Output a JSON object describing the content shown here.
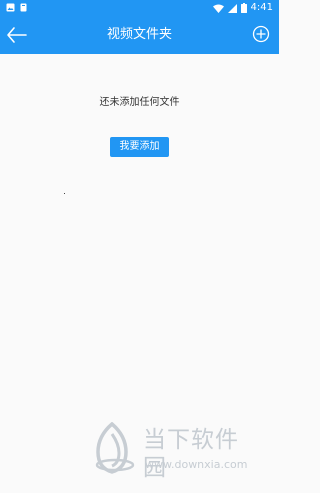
{
  "status_bar": {
    "time": "4:41",
    "icons": [
      "image-notification-icon",
      "card-notification-icon",
      "wifi-icon",
      "signal-icon",
      "battery-icon"
    ]
  },
  "app_bar": {
    "title": "视频文件夹",
    "back_icon": "back-arrow-icon",
    "add_icon": "add-circle-icon",
    "color": "#2196f3"
  },
  "content": {
    "empty_message": "还未添加任何文件",
    "add_button_label": "我要添加"
  },
  "watermark": {
    "name": "当下软件园",
    "url": "www.downxia.com",
    "color": "#c7cdd3"
  }
}
